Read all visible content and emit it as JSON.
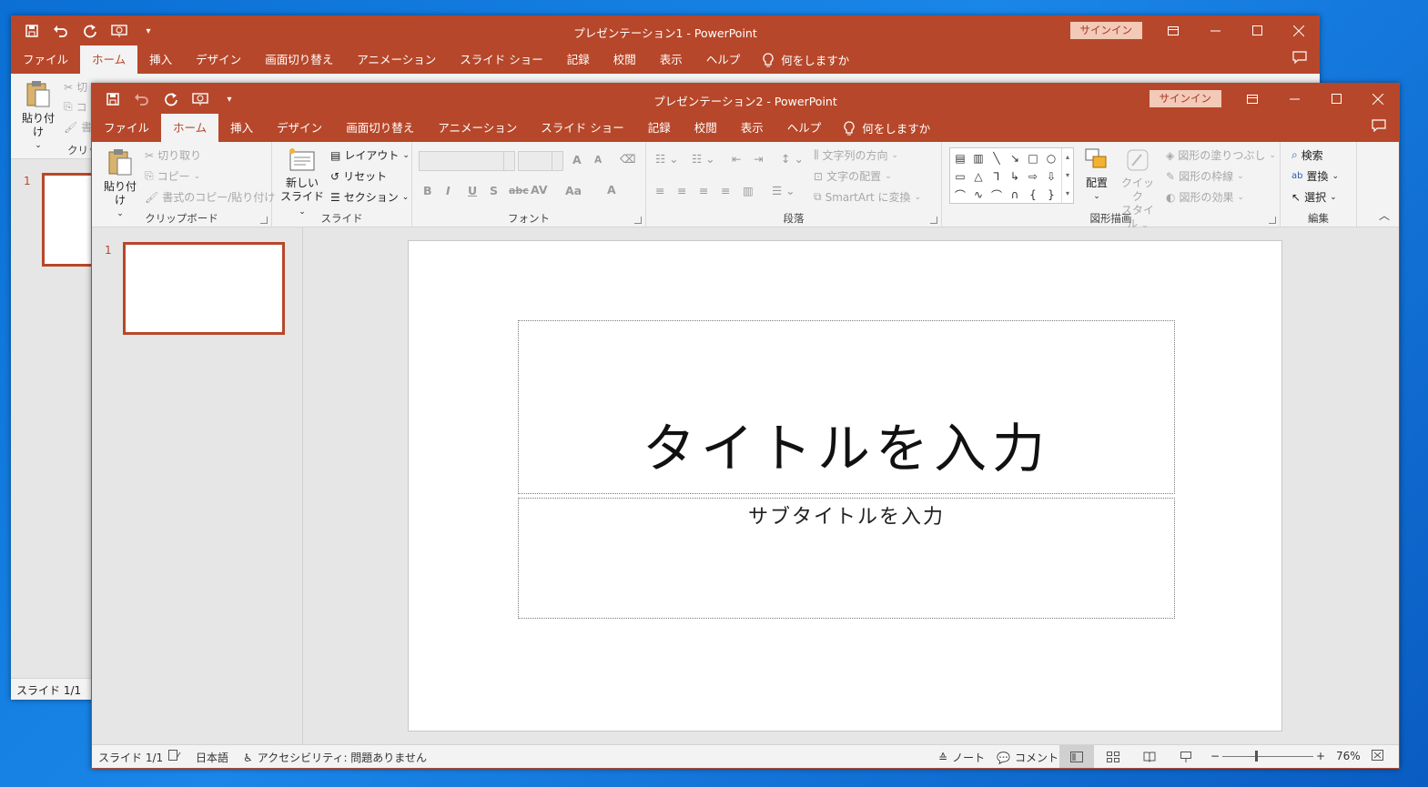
{
  "colors": {
    "accent": "#b7472a",
    "signin_bg": "#f3c9b8",
    "desktop": "#0b6fd4"
  },
  "window1": {
    "title": "プレゼンテーション1  -  PowerPoint",
    "signin": "サインイン",
    "tabs": [
      "ファイル",
      "ホーム",
      "挿入",
      "デザイン",
      "画面切り替え",
      "アニメーション",
      "スライド ショー",
      "記録",
      "校閲",
      "表示",
      "ヘルプ"
    ],
    "tell_me": "何をしますか",
    "paste_label": "貼り付け",
    "clipboard_partial": "クリップ",
    "cut_partial": "切",
    "copy_partial": "コ",
    "format_partial": "書",
    "slide_number": "1",
    "status_slide": "スライド 1/1"
  },
  "window2": {
    "title": "プレゼンテーション2  -  PowerPoint",
    "signin": "サインイン",
    "tabs": [
      "ファイル",
      "ホーム",
      "挿入",
      "デザイン",
      "画面切り替え",
      "アニメーション",
      "スライド ショー",
      "記録",
      "校閲",
      "表示",
      "ヘルプ"
    ],
    "active_tab": "ホーム",
    "tell_me": "何をしますか",
    "ribbon": {
      "clipboard": {
        "label": "クリップボード",
        "paste": "貼り付け",
        "cut": "切り取り",
        "copy": "コピー",
        "format_painter": "書式のコピー/貼り付け"
      },
      "slides": {
        "label": "スライド",
        "new_slide_line1": "新しい",
        "new_slide_line2": "スライド",
        "layout": "レイアウト",
        "reset": "リセット",
        "section": "セクション"
      },
      "font": {
        "label": "フォント",
        "grow": "A",
        "shrink": "A",
        "bold": "B",
        "italic": "I",
        "underline": "U",
        "shadow": "S",
        "strike": "abc",
        "spacing": "AV",
        "case": "Aa",
        "color": "A"
      },
      "paragraph": {
        "label": "段落",
        "text_direction": "文字列の方向",
        "align_text": "文字の配置",
        "smartart": "SmartArt に変換"
      },
      "drawing": {
        "label": "図形描画",
        "arrange": "配置",
        "quick_styles_line1": "クイック",
        "quick_styles_line2": "スタイル",
        "shape_fill": "図形の塗りつぶし",
        "shape_outline": "図形の枠線",
        "shape_effects": "図形の効果"
      },
      "editing": {
        "label": "編集",
        "find": "検索",
        "replace": "置換",
        "select": "選択"
      }
    },
    "slide_number": "1",
    "title_placeholder": "タイトルを入力",
    "subtitle_placeholder": "サブタイトルを入力",
    "status": {
      "slide": "スライド 1/1",
      "language": "日本語",
      "accessibility": "アクセシビリティ: 問題ありません",
      "notes": "ノート",
      "comments": "コメント",
      "zoom": "76%",
      "zoom_minus": "−",
      "zoom_plus": "+"
    }
  }
}
